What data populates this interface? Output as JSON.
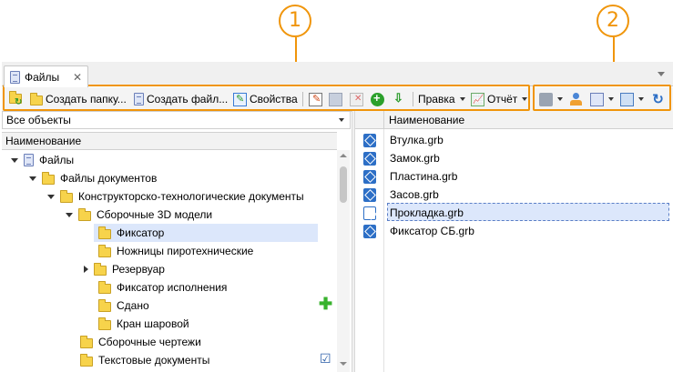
{
  "callouts": {
    "c1": "1",
    "c2": "2"
  },
  "tab": {
    "label": "Файлы",
    "close": "✕"
  },
  "toolbar": {
    "create_folder": "Создать папку...",
    "create_file": "Создать файл...",
    "properties": "Свойства",
    "edit_menu": "Правка",
    "report_menu": "Отчёт"
  },
  "left": {
    "filter": "Все объекты",
    "column": "Наименование",
    "tree": [
      {
        "label": "Файлы"
      },
      {
        "label": "Файлы документов"
      },
      {
        "label": "Конструкторско-технологические документы"
      },
      {
        "label": "Сборочные 3D модели"
      },
      {
        "label": "Фиксатор"
      },
      {
        "label": "Ножницы пиротехнические"
      },
      {
        "label": "Резервуар"
      },
      {
        "label": "Фиксатор исполнения"
      },
      {
        "label": "Сдано"
      },
      {
        "label": "Кран шаровой"
      },
      {
        "label": "Сборочные чертежи"
      },
      {
        "label": "Текстовые документы"
      }
    ]
  },
  "right": {
    "column": "Наименование",
    "files": [
      "Втулка.grb",
      "Замок.grb",
      "Пластина.grb",
      "Засов.grb",
      "Прокладка.grb",
      "Фиксатор СБ.grb"
    ]
  },
  "colors": {
    "accent": "#f0950a",
    "selection": "#dce7fb"
  }
}
